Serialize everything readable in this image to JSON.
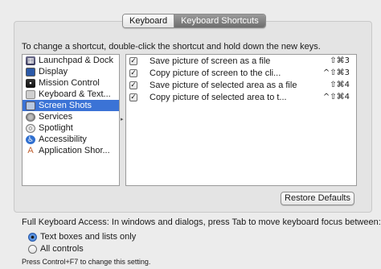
{
  "tabs": [
    {
      "label": "Keyboard",
      "active": false
    },
    {
      "label": "Keyboard Shortcuts",
      "active": true
    }
  ],
  "instruction": "To change a shortcut, double-click the shortcut and hold down the new keys.",
  "categories": [
    {
      "label": "Launchpad & Dock",
      "icon": "launchpad-icon"
    },
    {
      "label": "Display",
      "icon": "display-icon"
    },
    {
      "label": "Mission Control",
      "icon": "mission-control-icon"
    },
    {
      "label": "Keyboard & Text...",
      "icon": "keyboard-icon"
    },
    {
      "label": "Screen Shots",
      "icon": "screenshot-icon",
      "selected": true
    },
    {
      "label": "Services",
      "icon": "gear-icon"
    },
    {
      "label": "Spotlight",
      "icon": "spotlight-icon"
    },
    {
      "label": "Accessibility",
      "icon": "accessibility-icon"
    },
    {
      "label": "Application Shor...",
      "icon": "application-icon"
    }
  ],
  "shortcuts": [
    {
      "checked": true,
      "label": "Save picture of screen as a file",
      "keys": "⇧⌘3"
    },
    {
      "checked": true,
      "label": "Copy picture of screen to the cli...",
      "keys": "^⇧⌘3"
    },
    {
      "checked": true,
      "label": "Save picture of selected area as a file",
      "keys": "⇧⌘4"
    },
    {
      "checked": true,
      "label": "Copy picture of selected area to t...",
      "keys": "^⇧⌘4"
    }
  ],
  "restore_label": "Restore Defaults",
  "full_keyboard_access": {
    "label": "Full Keyboard Access: In windows and dialogs, press Tab to move keyboard focus between:",
    "options": [
      {
        "label": "Text boxes and lists only",
        "selected": true
      },
      {
        "label": "All controls",
        "selected": false
      }
    ],
    "hint": "Press Control+F7 to change this setting."
  },
  "colors": {
    "selection": "#3b73d6",
    "background": "#ececec"
  }
}
